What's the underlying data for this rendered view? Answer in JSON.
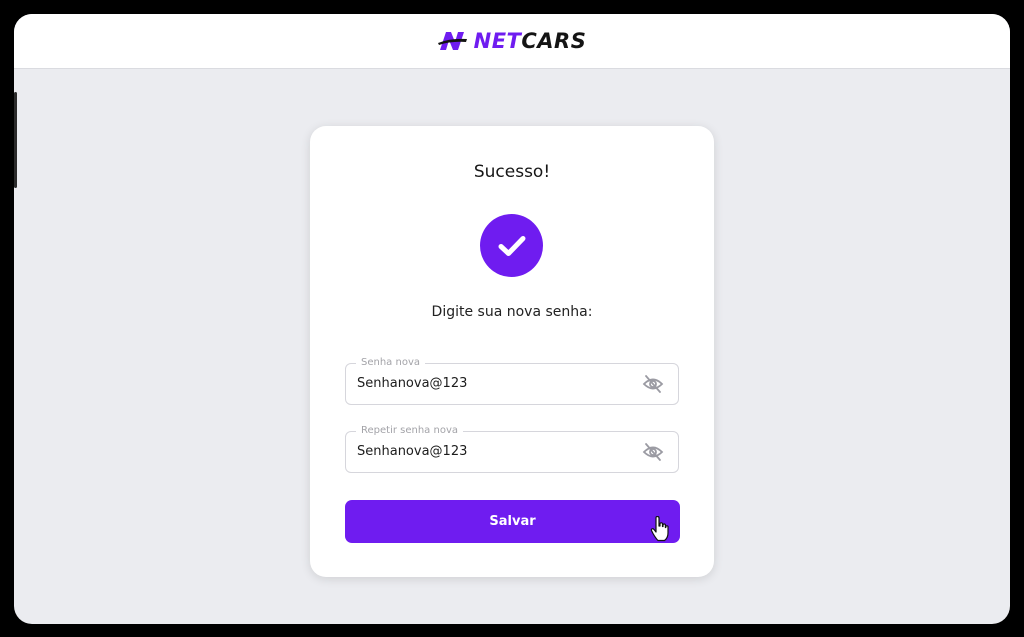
{
  "header": {
    "logo_net": "NET",
    "logo_cars": "CARS"
  },
  "card": {
    "title": "Sucesso!",
    "status_icon": "check-icon",
    "subtitle": "Digite sua nova senha:",
    "new_password": {
      "label": "Senha nova",
      "value": "Senhanova@123",
      "icon": "eye-off-icon"
    },
    "repeat_password": {
      "label": "Repetir senha nova",
      "value": "Senhanova@123",
      "icon": "eye-off-icon"
    },
    "save_label": "Salvar"
  },
  "colors": {
    "accent": "#6f1cf0",
    "background": "#ebecf0",
    "card": "#ffffff",
    "text": "#161616",
    "field_border": "#d6d6dc",
    "field_label": "#a3a3a8"
  }
}
